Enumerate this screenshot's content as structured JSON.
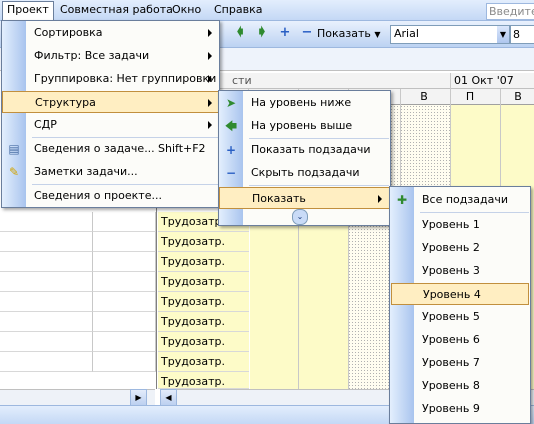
{
  "menubar": {
    "project": "Проект",
    "collab": "Совместная работа",
    "window": "Окно",
    "help": "Справка",
    "help_box": "Введите"
  },
  "toolbar": {
    "show_label": "Показать",
    "font": "Arial",
    "size": "8"
  },
  "timeline": {
    "date": "01 Окт '07",
    "days_left": "В",
    "days": [
      "В",
      "П",
      "В"
    ],
    "header_fragment": "сти"
  },
  "grid": {
    "row_label": "Трудозатр.",
    "visible_row_count": 9
  },
  "project_menu": {
    "items": [
      {
        "label": "Сортировка",
        "submenu": true
      },
      {
        "label": "Фильтр: Все задачи",
        "submenu": true
      },
      {
        "label": "Группировка: Нет группировки",
        "submenu": true
      },
      {
        "label": "Структура",
        "submenu": true,
        "selected": true
      },
      {
        "label": "СДР",
        "submenu": true
      },
      {
        "label": "Сведения о задаче...",
        "shortcut": "Shift+F2"
      },
      {
        "label": "Заметки задачи..."
      },
      {
        "label": "Сведения о проекте..."
      }
    ]
  },
  "structure_menu": {
    "items": [
      {
        "label": "На уровень ниже",
        "icon": "arrow-right-green-icon"
      },
      {
        "label": "На уровень выше",
        "icon": "arrow-left-green-icon"
      },
      {
        "label": "Показать подзадачи",
        "icon": "plus-blue-icon"
      },
      {
        "label": "Скрыть подзадачи",
        "icon": "minus-blue-icon"
      },
      {
        "label": "Показать",
        "submenu": true,
        "selected": true
      }
    ],
    "expand_icon": "double-chevron-down-icon"
  },
  "show_menu": {
    "items": [
      {
        "label": "Все подзадачи",
        "icon": "plus-plus-green-icon"
      },
      {
        "label": "Уровень 1"
      },
      {
        "label": "Уровень 2"
      },
      {
        "label": "Уровень 3"
      },
      {
        "label": "Уровень 4",
        "selected": true
      },
      {
        "label": "Уровень 5"
      },
      {
        "label": "Уровень 6"
      },
      {
        "label": "Уровень 7"
      },
      {
        "label": "Уровень 8"
      },
      {
        "label": "Уровень 9"
      }
    ]
  },
  "colors": {
    "menu_selected": "#ffeec2",
    "menu_selected_border": "#c18f3e",
    "grid_yellow": "#fdfbc8",
    "gutter": "#a9c4ee"
  }
}
